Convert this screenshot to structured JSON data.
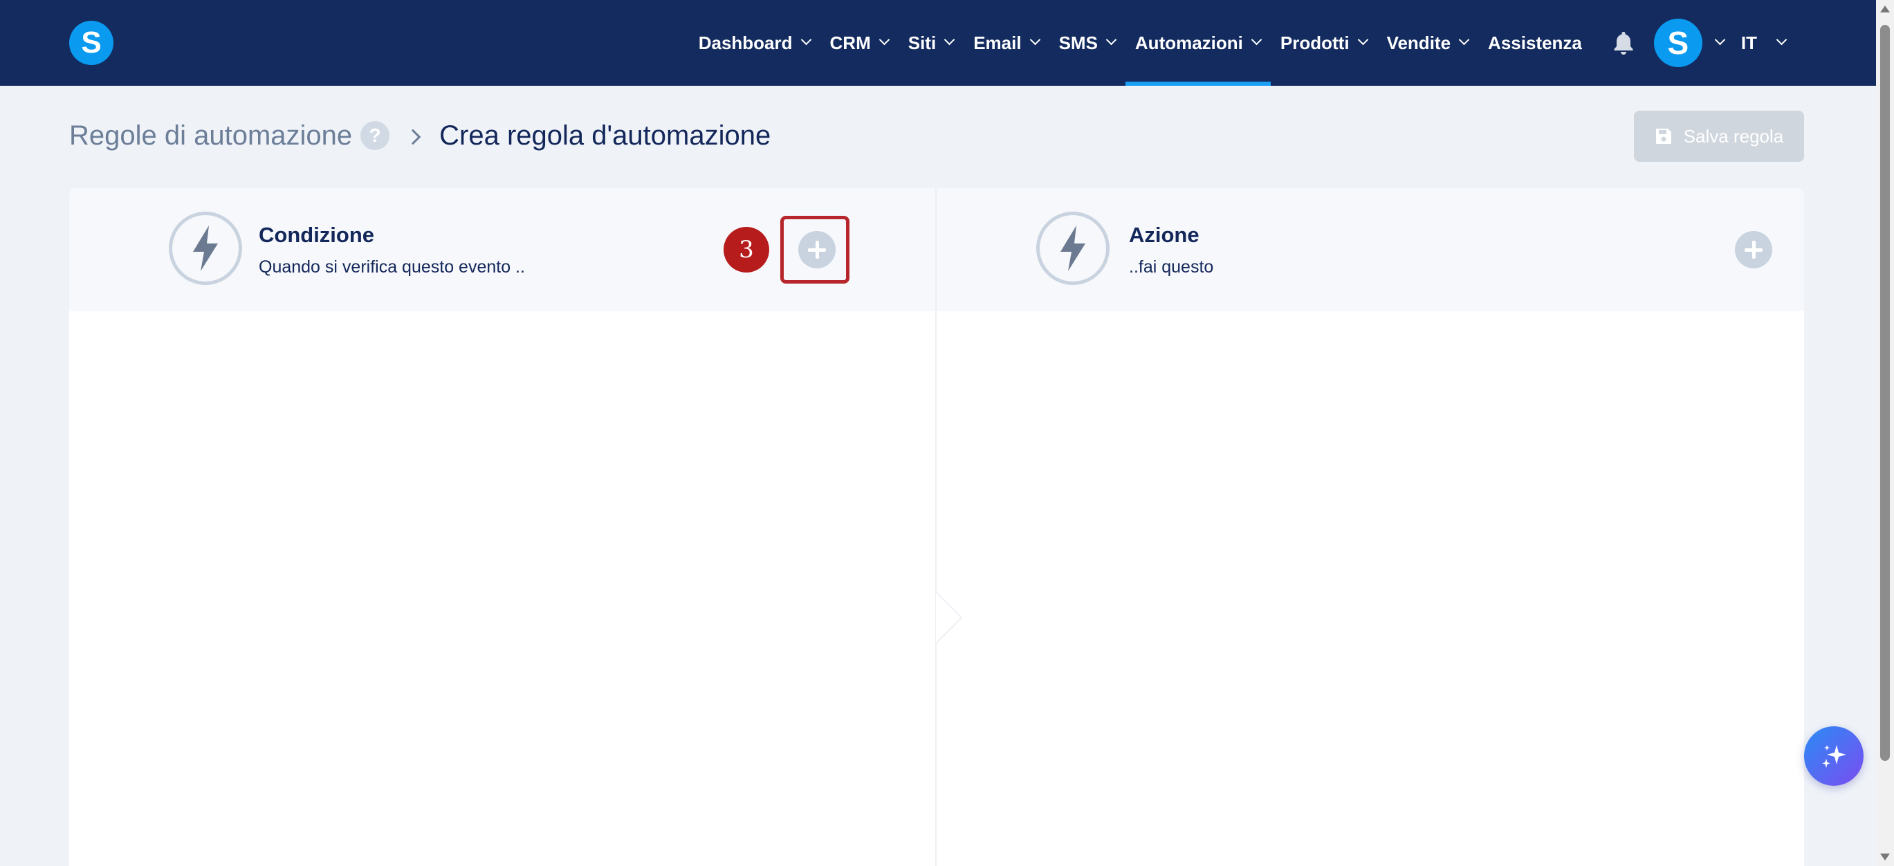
{
  "navbar": {
    "logo_letter": "S",
    "items": [
      {
        "label": "Dashboard",
        "has_dropdown": true
      },
      {
        "label": "CRM",
        "has_dropdown": true
      },
      {
        "label": "Siti",
        "has_dropdown": true
      },
      {
        "label": "Email",
        "has_dropdown": true
      },
      {
        "label": "SMS",
        "has_dropdown": true
      },
      {
        "label": "Automazioni",
        "has_dropdown": true,
        "active": true
      },
      {
        "label": "Prodotti",
        "has_dropdown": true
      },
      {
        "label": "Vendite",
        "has_dropdown": true
      },
      {
        "label": "Assistenza",
        "has_dropdown": false
      }
    ],
    "bell_icon": "bell-icon",
    "avatar_letter": "S",
    "language": "IT"
  },
  "breadcrumb": {
    "parent": "Regole di automazione",
    "help": "?",
    "current": "Crea regola d'automazione"
  },
  "toolbar": {
    "save_label": "Salva regola"
  },
  "builder": {
    "condition": {
      "title": "Condizione",
      "subtitle": "Quando si verifica questo evento .."
    },
    "action": {
      "title": "Azione",
      "subtitle": "..fai questo"
    },
    "step_badge": "3"
  },
  "colors": {
    "navbar_bg": "#132b5e",
    "accent": "#0a9af0",
    "active_underline": "#1aa0f5",
    "highlight": "#b7262d"
  }
}
